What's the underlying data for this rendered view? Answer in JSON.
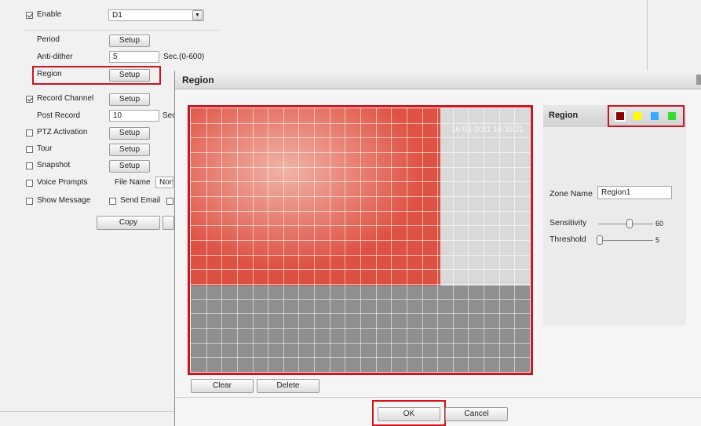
{
  "settings": {
    "enable_label": "Enable",
    "resolution_value": "D1",
    "period_label": "Period",
    "anti_dither_label": "Anti-dither",
    "anti_dither_value": "5",
    "anti_dither_unit": "Sec.(0-600)",
    "region_label": "Region",
    "record_channel_label": "Record Channel",
    "post_record_label": "Post Record",
    "post_record_value": "10",
    "post_record_unit": "Sec",
    "ptz_activation_label": "PTZ Activation",
    "tour_label": "Tour",
    "snapshot_label": "Snapshot",
    "voice_prompts_label": "Voice Prompts",
    "file_name_label": "File Name",
    "file_name_value": "None",
    "show_message_label": "Show Message",
    "send_email_label": "Send Email",
    "setup_label": "Setup",
    "copy_label": "Copy"
  },
  "dialog": {
    "title": "Region",
    "timestamp": "16-03-2011 16:35:21",
    "clear_label": "Clear",
    "delete_label": "Delete",
    "ok_label": "OK",
    "cancel_label": "Cancel"
  },
  "region_panel": {
    "header": "Region",
    "zone_name_label": "Zone Name",
    "zone_name_value": "Region1",
    "sensitivity_label": "Sensitivity",
    "sensitivity_value": "60",
    "threshold_label": "Threshold",
    "threshold_value": "5",
    "colors": [
      "#8b0000",
      "#ffff00",
      "#33aaff",
      "#33dd33"
    ],
    "swatch_names": [
      "region-color-darkred",
      "region-color-yellow",
      "region-color-blue",
      "region-color-green"
    ]
  }
}
